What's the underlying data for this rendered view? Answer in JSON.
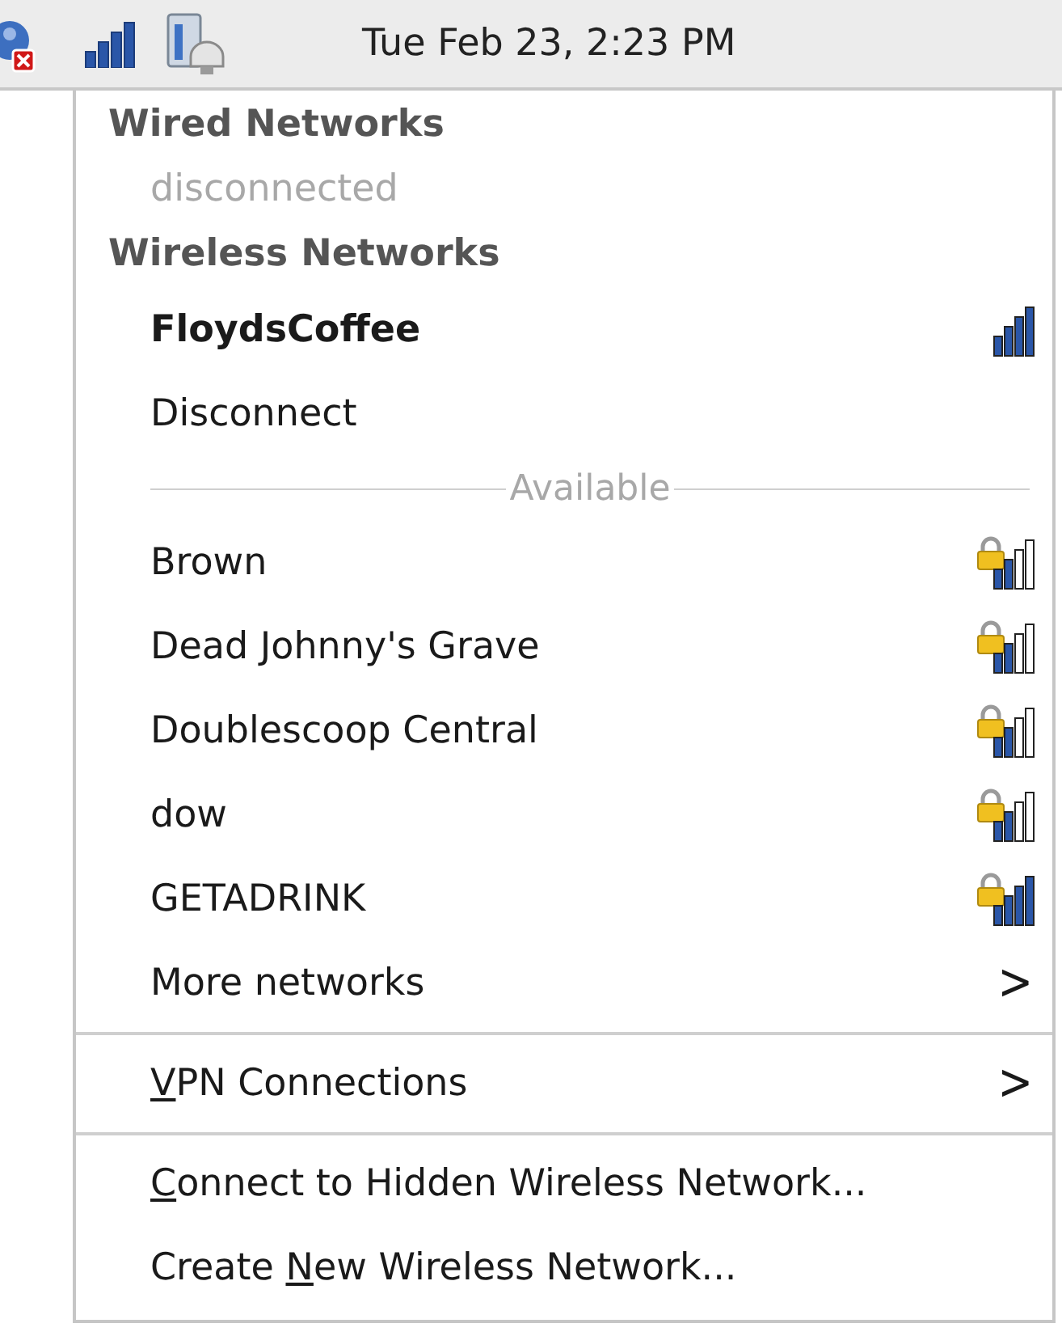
{
  "panel": {
    "clock": "Tue Feb 23,  2:23 PM",
    "network_error": true
  },
  "menu": {
    "items": [
      {
        "kind": "header",
        "label": "Wired Networks"
      },
      {
        "kind": "item",
        "label": "disconnected",
        "disabled": true
      },
      {
        "kind": "header",
        "label": "Wireless Networks"
      },
      {
        "kind": "network",
        "label": "FloydsCoffee",
        "active": true,
        "secured": false,
        "full_signal": true
      },
      {
        "kind": "item",
        "label": "Disconnect",
        "disabled": false
      },
      {
        "kind": "caption",
        "label": "Available"
      },
      {
        "kind": "network",
        "label": "Brown",
        "active": false,
        "secured": true,
        "full_signal": false
      },
      {
        "kind": "network",
        "label": "Dead Johnny's Grave",
        "active": false,
        "secured": true,
        "full_signal": false
      },
      {
        "kind": "network",
        "label": "Doublescoop Central",
        "active": false,
        "secured": true,
        "full_signal": false
      },
      {
        "kind": "network",
        "label": "dow",
        "active": false,
        "secured": true,
        "full_signal": false
      },
      {
        "kind": "network",
        "label": "GETADRINK",
        "active": false,
        "secured": true,
        "full_signal": true
      },
      {
        "kind": "submenu",
        "label": "More networks",
        "arrow": ">"
      },
      {
        "kind": "separator"
      },
      {
        "kind": "submenu",
        "parts": [
          {
            "text": "V",
            "underline": true
          },
          {
            "text": "PN Connections",
            "underline": false
          }
        ],
        "arrow": ">"
      },
      {
        "kind": "separator"
      },
      {
        "kind": "item",
        "parts": [
          {
            "text": "C",
            "underline": true
          },
          {
            "text": "onnect to Hidden Wireless Network...",
            "underline": false
          }
        ],
        "disabled": false
      },
      {
        "kind": "item",
        "parts": [
          {
            "text": "Create ",
            "underline": false
          },
          {
            "text": "N",
            "underline": true
          },
          {
            "text": "ew Wireless Network...",
            "underline": false
          }
        ],
        "disabled": false
      }
    ]
  }
}
